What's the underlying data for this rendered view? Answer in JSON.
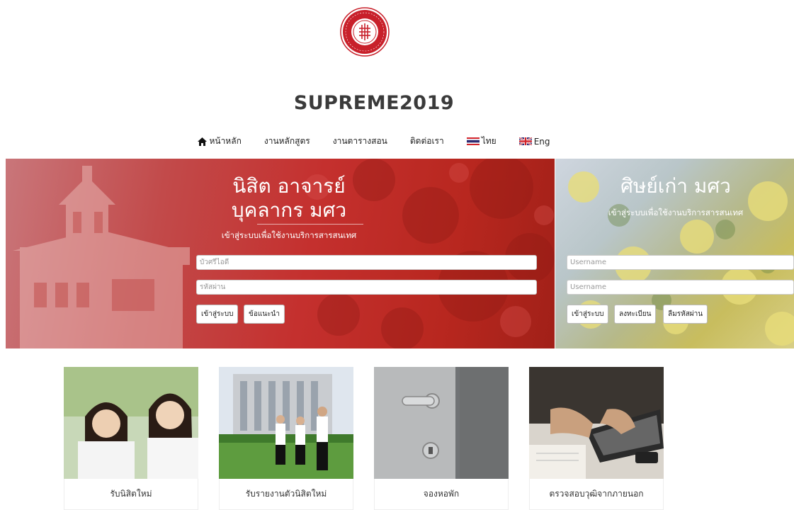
{
  "site": {
    "title": "SUPREME2019"
  },
  "nav": {
    "home": "หน้าหลัก",
    "curriculum": "งานหลักสูตร",
    "timetable": "งานตารางสอน",
    "contact": "ติดต่อเรา",
    "thai": "ไทย",
    "english": "Eng"
  },
  "staff_login": {
    "title_line1": "นิสิต อาจารย์",
    "title_line2": "บุคลากร มศว",
    "subtitle": "เข้าสู่ระบบเพื่อใช้งานบริการสารสนเทศ",
    "username_placeholder": "บัวศรีไอดี",
    "password_placeholder": "รหัสผ่าน",
    "login_label": "เข้าสู่ระบบ",
    "advice_label": "ข้อแนะนำ"
  },
  "alumni_login": {
    "title": "ศิษย์เก่า มศว",
    "subtitle": "เข้าสู่ระบบเพื่อใช้งานบริการสารสนเทศ",
    "username_placeholder": "Username",
    "password_placeholder": "Username",
    "login_label": "เข้าสู่ระบบ",
    "register_label": "ลงทะเบียน",
    "forgot_label": "ลืมรหัสผ่าน"
  },
  "cards": [
    {
      "label": "รับนิสิตใหม่"
    },
    {
      "label": "รับรายงานตัวนิสิตใหม่"
    },
    {
      "label": "จองหอพัก"
    },
    {
      "label": "ตรวจสอบวุฒิจากภายนอก"
    }
  ],
  "colors": {
    "brand_red": "#c4302e",
    "flag_blue": "#2d2a72",
    "flag_red": "#d2232a"
  }
}
